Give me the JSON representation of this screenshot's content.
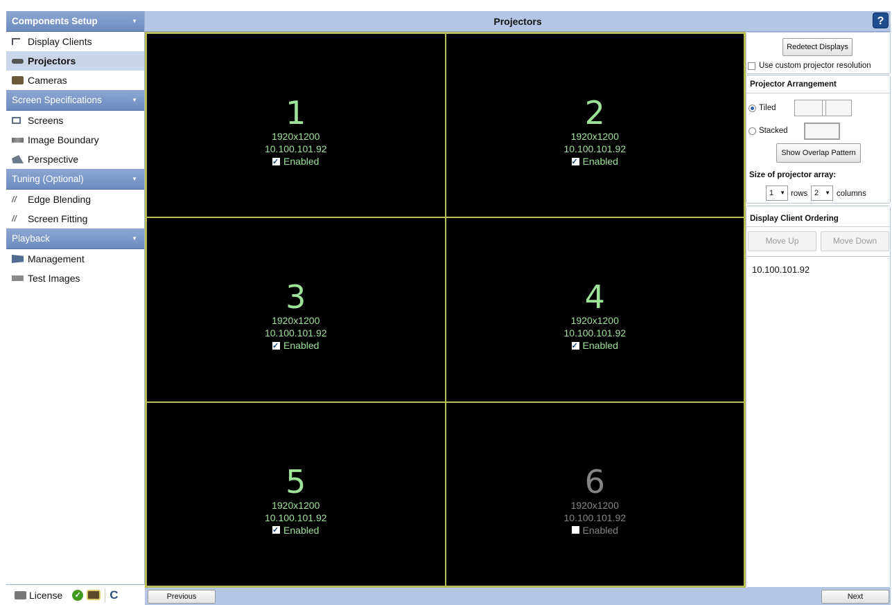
{
  "sidebar": {
    "sections": [
      {
        "title": "Components Setup",
        "items": [
          "Display Clients",
          "Projectors",
          "Cameras"
        ]
      },
      {
        "title": "Screen Specifications",
        "items": [
          "Screens",
          "Image Boundary",
          "Perspective"
        ]
      },
      {
        "title": "Tuning (Optional)",
        "items": [
          "Edge Blending",
          "Screen Fitting"
        ]
      },
      {
        "title": "Playback",
        "items": [
          "Management",
          "Test Images"
        ]
      }
    ],
    "selected_item": "Projectors",
    "footer": {
      "license_label": "License"
    }
  },
  "header": {
    "title": "Projectors",
    "help": "?"
  },
  "projectors": [
    {
      "number": "1",
      "resolution": "1920x1200",
      "ip": "10.100.101.92",
      "enabled_label": "Enabled",
      "enabled": true
    },
    {
      "number": "2",
      "resolution": "1920x1200",
      "ip": "10.100.101.92",
      "enabled_label": "Enabled",
      "enabled": true
    },
    {
      "number": "3",
      "resolution": "1920x1200",
      "ip": "10.100.101.92",
      "enabled_label": "Enabled",
      "enabled": true
    },
    {
      "number": "4",
      "resolution": "1920x1200",
      "ip": "10.100.101.92",
      "enabled_label": "Enabled",
      "enabled": true
    },
    {
      "number": "5",
      "resolution": "1920x1200",
      "ip": "10.100.101.92",
      "enabled_label": "Enabled",
      "enabled": true
    },
    {
      "number": "6",
      "resolution": "1920x1200",
      "ip": "10.100.101.92",
      "enabled_label": "Enabled",
      "enabled": false
    }
  ],
  "right_panel": {
    "redetect_label": "Redetect Displays",
    "custom_resolution_label": "Use custom projector resolution",
    "arrangement": {
      "title": "Projector Arrangement",
      "tiled_label": "Tiled",
      "stacked_label": "Stacked",
      "selected": "Tiled",
      "overlap_label": "Show Overlap Pattern",
      "size_label": "Size of projector array:",
      "rows_value": "1",
      "rows_label": "rows",
      "columns_value": "2",
      "columns_label": "columns"
    },
    "ordering": {
      "title": "Display Client Ordering",
      "move_up_label": "Move Up",
      "move_down_label": "Move Down",
      "clients": [
        "10.100.101.92"
      ]
    }
  },
  "footer": {
    "previous_label": "Previous",
    "next_label": "Next"
  },
  "colors": {
    "header_blue": "#b3c6e3",
    "section_blue": "#7c98c8",
    "grid_line": "#b9bd5a",
    "enabled_text": "#9fe29a",
    "disabled_text": "#858585"
  }
}
